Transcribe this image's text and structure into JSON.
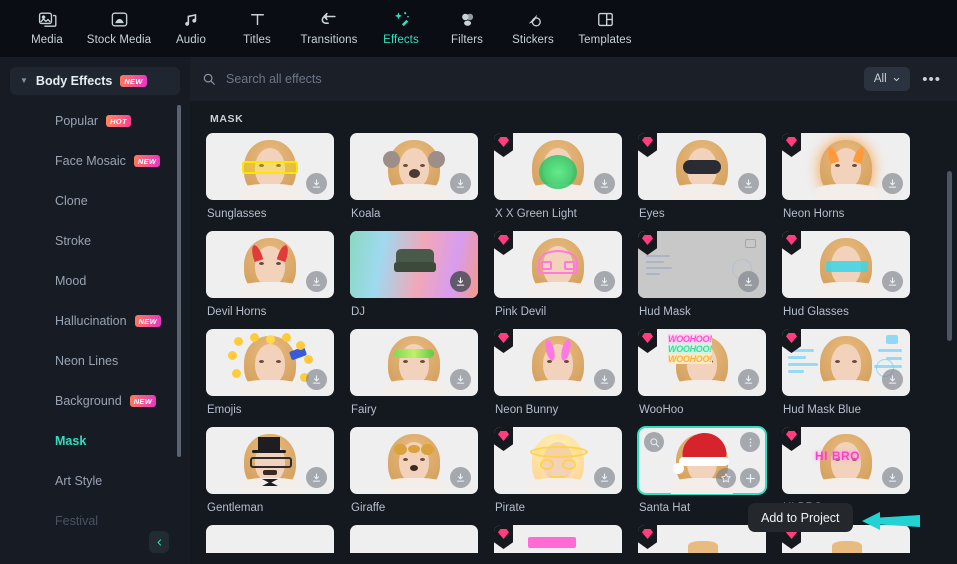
{
  "topnav": {
    "items": [
      {
        "label": "Media",
        "icon": "media-icon",
        "active": false
      },
      {
        "label": "Stock Media",
        "icon": "stock-media-icon",
        "active": false
      },
      {
        "label": "Audio",
        "icon": "audio-note-icon",
        "active": false
      },
      {
        "label": "Titles",
        "icon": "titles-text-icon",
        "active": false
      },
      {
        "label": "Transitions",
        "icon": "transitions-arrow-icon",
        "active": false
      },
      {
        "label": "Effects",
        "icon": "effects-sparkle-icon",
        "active": true
      },
      {
        "label": "Filters",
        "icon": "filters-circles-icon",
        "active": false
      },
      {
        "label": "Stickers",
        "icon": "stickers-icon",
        "active": false
      },
      {
        "label": "Templates",
        "icon": "templates-layout-icon",
        "active": false
      }
    ]
  },
  "sidebar": {
    "category": {
      "label": "Body Effects",
      "badge": "NEW"
    },
    "items": [
      {
        "label": "Popular",
        "badge": "HOT",
        "state": "normal"
      },
      {
        "label": "Face Mosaic",
        "badge": "NEW",
        "state": "normal"
      },
      {
        "label": "Clone",
        "badge": "",
        "state": "normal"
      },
      {
        "label": "Stroke",
        "badge": "",
        "state": "normal"
      },
      {
        "label": "Mood",
        "badge": "",
        "state": "normal"
      },
      {
        "label": "Hallucination",
        "badge": "NEW",
        "state": "normal"
      },
      {
        "label": "Neon Lines",
        "badge": "",
        "state": "normal"
      },
      {
        "label": "Background",
        "badge": "NEW",
        "state": "normal"
      },
      {
        "label": "Mask",
        "badge": "",
        "state": "selected"
      },
      {
        "label": "Art Style",
        "badge": "",
        "state": "normal"
      },
      {
        "label": "Festival",
        "badge": "",
        "state": "faded"
      }
    ],
    "collapse_icon": "chevron-left-icon"
  },
  "search": {
    "placeholder": "Search all effects",
    "value": "",
    "icon": "search-icon",
    "filter_label": "All",
    "filter_caret": "chevron-down-icon",
    "more_label": "•••"
  },
  "content": {
    "section_title": "MASK",
    "rows": [
      [
        {
          "name": "Sunglasses",
          "pro": false,
          "style": "sunglasses"
        },
        {
          "name": "Koala",
          "pro": false,
          "style": "koala"
        },
        {
          "name": "X X Green Light",
          "pro": true,
          "style": "greenlight"
        },
        {
          "name": "Eyes",
          "pro": true,
          "style": "eyes"
        },
        {
          "name": "Neon Horns",
          "pro": true,
          "style": "neonhorns"
        }
      ],
      [
        {
          "name": "Devil Horns",
          "pro": false,
          "style": "devilhorns"
        },
        {
          "name": "DJ",
          "pro": false,
          "style": "dj",
          "download_hover": true
        },
        {
          "name": "Pink Devil",
          "pro": true,
          "style": "pinkdevil"
        },
        {
          "name": "Hud Mask",
          "pro": true,
          "style": "hudmask"
        },
        {
          "name": "Hud Glasses",
          "pro": true,
          "style": "hudglasses"
        }
      ],
      [
        {
          "name": "Emojis",
          "pro": false,
          "style": "emojis"
        },
        {
          "name": "Fairy",
          "pro": false,
          "style": "fairy"
        },
        {
          "name": "Neon Bunny",
          "pro": true,
          "style": "neonbunny"
        },
        {
          "name": "WooHoo",
          "pro": true,
          "style": "woohoo"
        },
        {
          "name": "Hud Mask Blue",
          "pro": true,
          "style": "hudmaskblue"
        }
      ],
      [
        {
          "name": "Gentleman",
          "pro": false,
          "style": "gentleman"
        },
        {
          "name": "Giraffe",
          "pro": false,
          "style": "giraffe"
        },
        {
          "name": "Pirate",
          "pro": true,
          "style": "pirate"
        },
        {
          "name": "Santa Hat",
          "pro": false,
          "style": "santahat",
          "hovered": true
        },
        {
          "name": "HI BRO",
          "pro": true,
          "style": "hibro"
        }
      ]
    ],
    "partial_row": [
      {
        "pro": false
      },
      {
        "pro": false
      },
      {
        "pro": true
      },
      {
        "pro": true
      },
      {
        "pro": true
      }
    ],
    "card_overlay_icons": {
      "zoom": "magnifier-icon",
      "more": "more-vertical-icon",
      "favorite": "star-icon",
      "add": "plus-icon",
      "download": "download-icon"
    }
  },
  "tooltip": {
    "text": "Add to Project",
    "pointer_icon": "arrow-left-icon",
    "pointer_color": "#23d3d3"
  },
  "colors": {
    "accent": "#2fe0c0",
    "pro_badge": "#ff3d7f",
    "app_bg": "#14181f",
    "sidebar_bg": "#171c24",
    "topnav_bg": "#0a0e14"
  },
  "woohoo_lines": [
    "WOOHOO!",
    "WOOHOO!",
    "WOOHOO!"
  ]
}
